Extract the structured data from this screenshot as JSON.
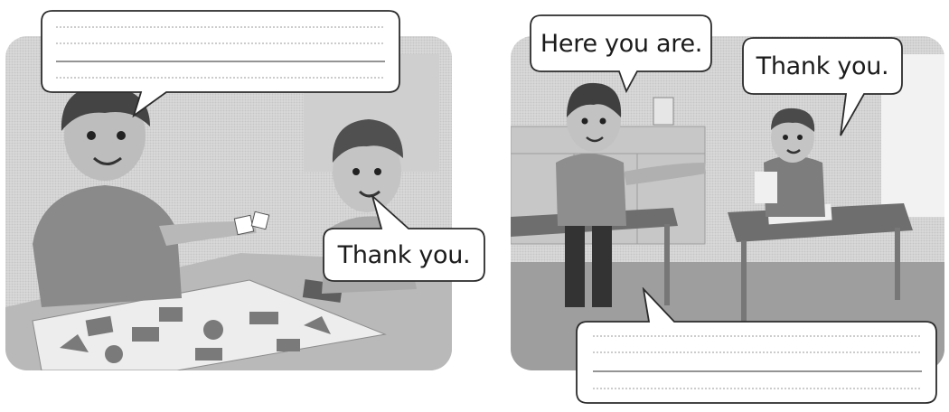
{
  "left_scene": {
    "speech_bubble_small": "Thank you."
  },
  "right_scene": {
    "speech_bubble_girl": "Here you are.",
    "speech_bubble_boy": "Thank you."
  },
  "colors": {
    "panel_background": "#dcdcdc",
    "bubble_fill": "#ffffff",
    "outline": "#2b2b2b",
    "writing_line": "#9a9a9a"
  }
}
